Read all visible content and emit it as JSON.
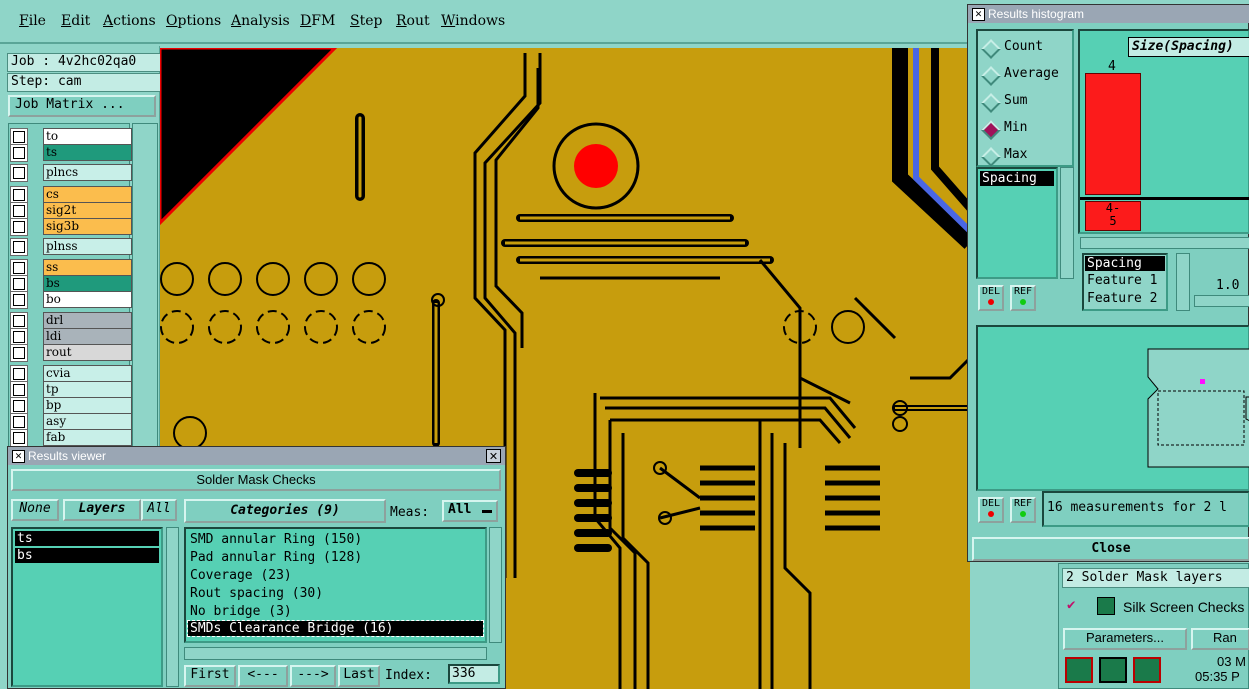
{
  "menu": [
    "File",
    "Edit",
    "Actions",
    "Options",
    "Analysis",
    "DFM",
    "Step",
    "Rout",
    "Windows"
  ],
  "job": {
    "job_label": "Job : 4v2hc02qa0",
    "step_label": "Step: cam",
    "matrix_button": "Job Matrix ..."
  },
  "layers": [
    {
      "name": "to",
      "color": "#ffffff"
    },
    {
      "name": "ts",
      "color": "#1f9a7c"
    },
    {
      "name": "plncs",
      "color": "#c8efe8"
    },
    {
      "name": "cs",
      "color": "#fbbd4d"
    },
    {
      "name": "sig2t",
      "color": "#fbbd4d"
    },
    {
      "name": "sig3b",
      "color": "#fbbd4d"
    },
    {
      "name": "plnss",
      "color": "#c8efe8"
    },
    {
      "name": "ss",
      "color": "#fbbd4d"
    },
    {
      "name": "bs",
      "color": "#1f9a7c"
    },
    {
      "name": "bo",
      "color": "#ffffff"
    },
    {
      "name": "drl",
      "color": "#a9b3ba"
    },
    {
      "name": "ldi",
      "color": "#a9b3ba"
    },
    {
      "name": "rout",
      "color": "#d8d8d8"
    },
    {
      "name": "cvia",
      "color": "#c8efe8"
    },
    {
      "name": "tp",
      "color": "#c8efe8"
    },
    {
      "name": "bp",
      "color": "#c8efe8"
    },
    {
      "name": "asy",
      "color": "#c8efe8"
    },
    {
      "name": "fab",
      "color": "#c8efe8"
    }
  ],
  "results_viewer": {
    "title": "Results viewer",
    "heading": "Solder Mask Checks",
    "none_btn": "None",
    "layers_btn": "Layers",
    "all_btn": "All",
    "layer_items": [
      "ts",
      "bs"
    ],
    "categories_btn": "Categories (9)",
    "meas_label": "Meas:",
    "meas_value": "All",
    "categories": [
      "SMD annular Ring (150)",
      "Pad annular Ring (128)",
      "Coverage (23)",
      "Rout spacing (30)",
      "No bridge (3)",
      "SMDs Clearance Bridge (16)"
    ],
    "first_btn": "First",
    "prev_btn": "<---",
    "next_btn": "--->",
    "last_btn": "Last",
    "index_label": "Index:",
    "index_value": "336"
  },
  "histogram": {
    "title": "Results histogram",
    "modes": [
      "Count",
      "Average",
      "Sum",
      "Min",
      "Max"
    ],
    "selected_mode": "Min",
    "size_label": "Size(Spacing)",
    "bar_value": "4",
    "bin_label_1": "4-",
    "bin_label_2": "5",
    "list_item": "Spacing",
    "del_label": "DEL",
    "ref_label": "REF",
    "attrs": [
      "Spacing",
      "Feature 1",
      "Feature 2"
    ],
    "scale_value": "1.0",
    "measurements_text": "16 measurements for 2 l",
    "close_btn": "Close"
  },
  "bottom_right": {
    "layers_text": "2 Solder Mask layers",
    "silk_label": "Silk Screen Checks",
    "params_btn": "Parameters...",
    "run_btn": "Ran",
    "date": "03 M",
    "time": "05:35 P"
  },
  "colors": {
    "bg": "#8fd5c8",
    "board": "#c79d0d",
    "trace": "#000000",
    "accent_red": "#ff0000",
    "accent_blue": "#4a67e3"
  }
}
